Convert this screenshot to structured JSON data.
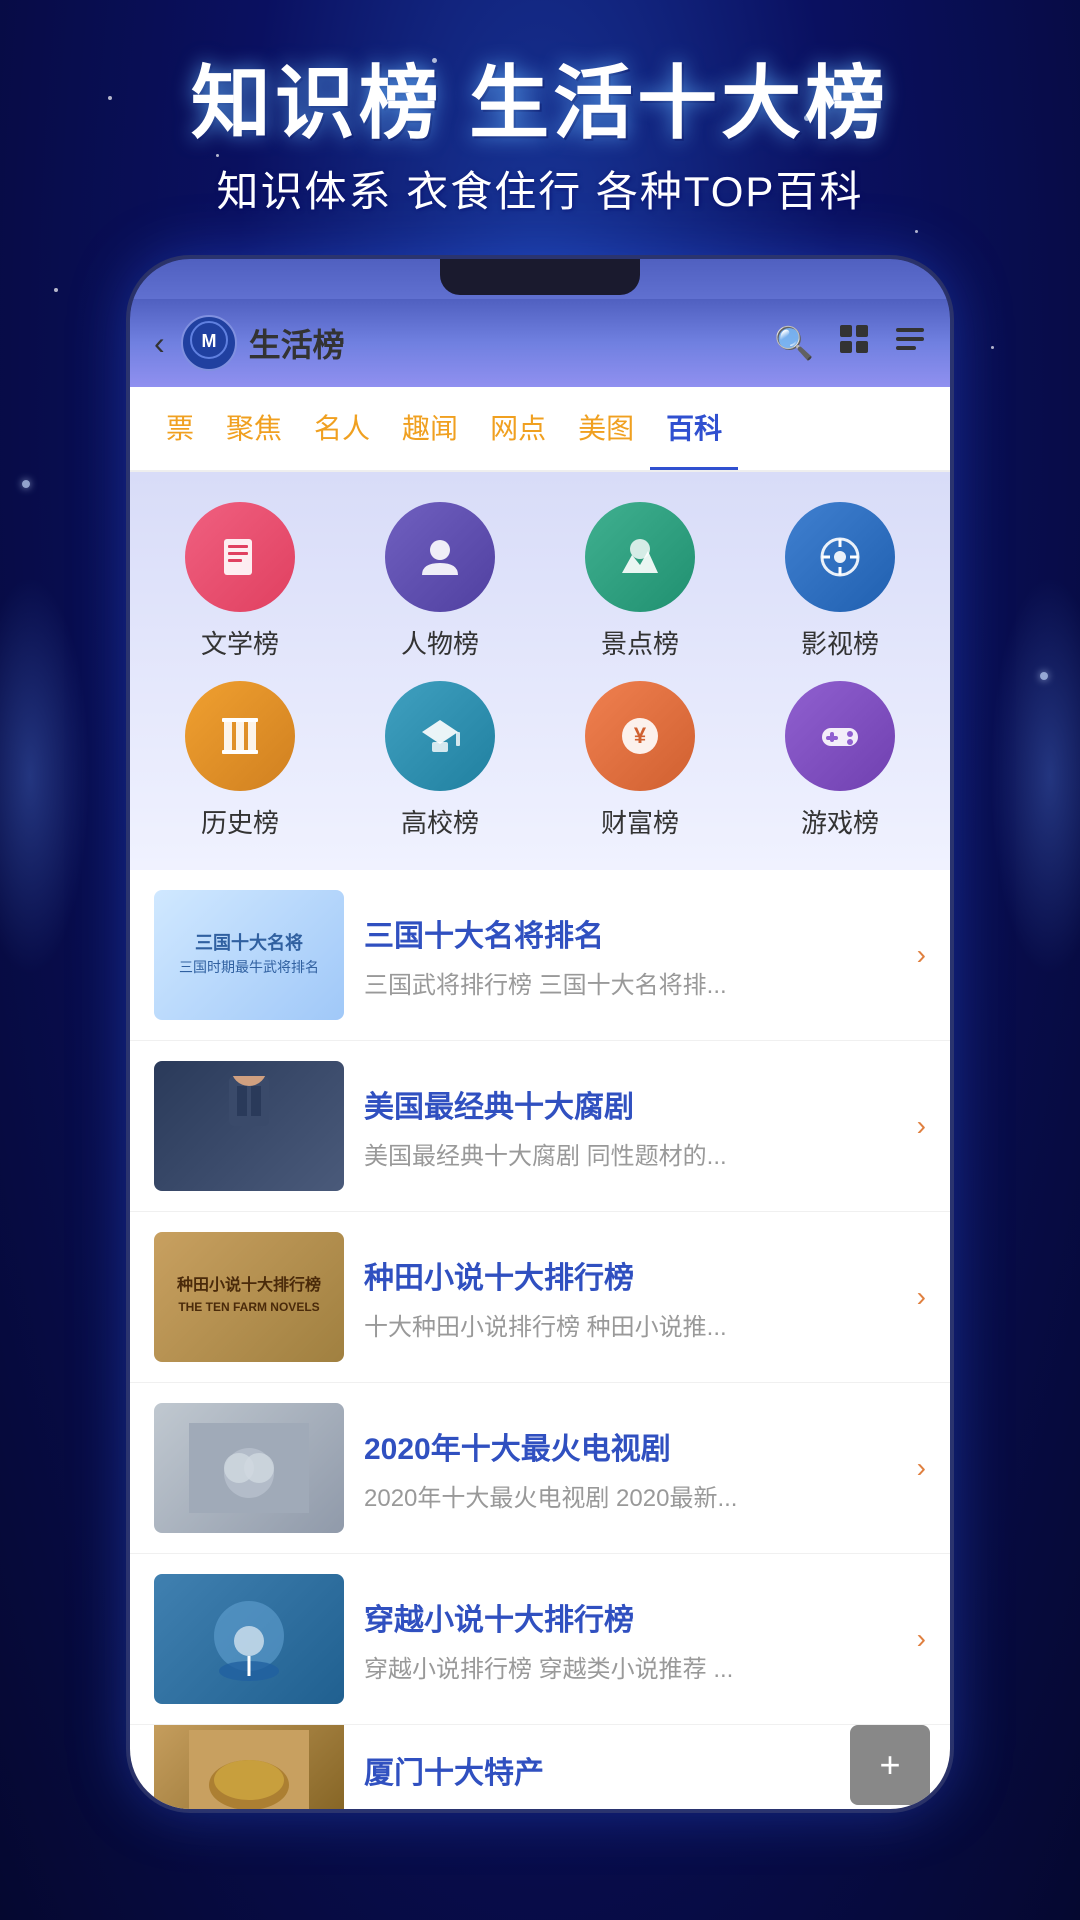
{
  "header": {
    "title_line1": "知识榜 生活十大榜",
    "subtitle": "知识体系 衣食住行 各种TOP百科"
  },
  "nav": {
    "back_label": "‹",
    "logo_text": "M",
    "page_title": "生活榜",
    "icons": [
      "search",
      "grid",
      "list"
    ]
  },
  "tabs": [
    {
      "label": "票",
      "active": false
    },
    {
      "label": "聚焦",
      "active": false
    },
    {
      "label": "名人",
      "active": false
    },
    {
      "label": "趣闻",
      "active": false
    },
    {
      "label": "网点",
      "active": false
    },
    {
      "label": "美图",
      "active": false
    },
    {
      "label": "百科",
      "active": true
    }
  ],
  "categories": [
    {
      "icon": "📖",
      "label": "文学榜",
      "color_class": "icon-literature"
    },
    {
      "icon": "👤",
      "label": "人物榜",
      "color_class": "icon-person"
    },
    {
      "icon": "🏔",
      "label": "景点榜",
      "color_class": "icon-scenery"
    },
    {
      "icon": "🎬",
      "label": "影视榜",
      "color_class": "icon-film"
    },
    {
      "icon": "📜",
      "label": "历史榜",
      "color_class": "icon-history"
    },
    {
      "icon": "🎓",
      "label": "高校榜",
      "color_class": "icon-college"
    },
    {
      "icon": "💰",
      "label": "财富榜",
      "color_class": "icon-wealth"
    },
    {
      "icon": "🎮",
      "label": "游戏榜",
      "color_class": "icon-game"
    }
  ],
  "list_items": [
    {
      "thumb_label": "三国十大名将\n三国时期最牛武将排名",
      "title": "三国十大名将排名",
      "desc": "三国武将排行榜 三国十大名将排...",
      "thumb_type": "light-blue"
    },
    {
      "thumb_label": "",
      "title": "美国最经典十大腐剧",
      "desc": "美国最经典十大腐剧 同性题材的...",
      "thumb_type": "dark-suit"
    },
    {
      "thumb_label": "种田小说十大排行榜\nTHE TEN FARM NOVELS",
      "title": "种田小说十大排行榜",
      "desc": "十大种田小说排行榜 种田小说推...",
      "thumb_type": "warm-book"
    },
    {
      "thumb_label": "",
      "title": "2020年十大最火电视剧",
      "desc": "2020年十大最火电视剧 2020最新...",
      "thumb_type": "couple"
    },
    {
      "thumb_label": "",
      "title": "穿越小说十大排行榜",
      "desc": "穿越小说排行榜 穿越类小说推荐 ...",
      "thumb_type": "blue-sky"
    },
    {
      "thumb_label": "",
      "title": "厦门十大特产",
      "desc": "",
      "thumb_type": "food"
    }
  ],
  "fab": {
    "label": "+"
  }
}
